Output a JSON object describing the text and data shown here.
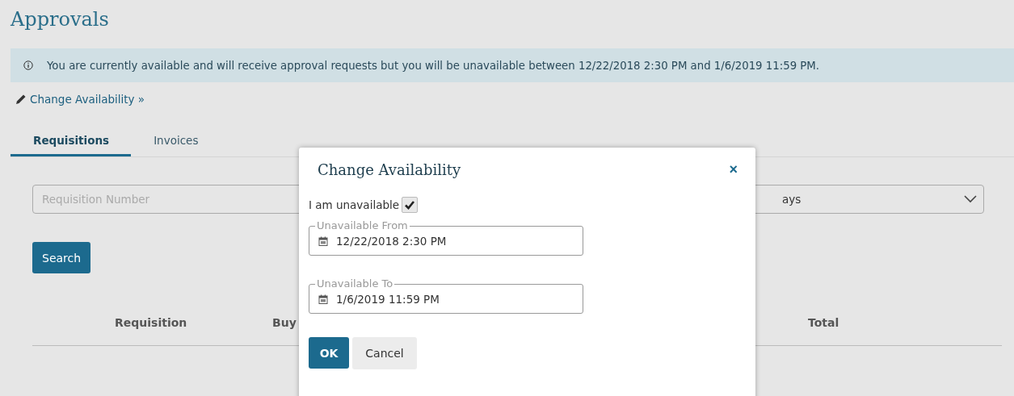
{
  "page": {
    "title": "Approvals"
  },
  "banner": {
    "text": "You are currently available and will receive approval requests but you will be unavailable between 12/22/2018 2:30 PM and 1/6/2019 11:59 PM."
  },
  "change_link": "Change Availability »",
  "tabs": [
    {
      "label": "Requisitions",
      "selected": true
    },
    {
      "label": "Invoices",
      "selected": false
    }
  ],
  "filters": {
    "search_placeholder": "Requisition Number",
    "select_value": "ays",
    "search_button": "Search"
  },
  "table": {
    "columns": [
      {
        "label": "Requisition"
      },
      {
        "label": "Buy"
      },
      {
        "label": "Total"
      }
    ]
  },
  "dialog": {
    "title": "Change Availability",
    "close": "×",
    "unavailable_label": "I am unavailable",
    "unavailable": true,
    "fields": [
      {
        "label": "Unavailable From",
        "value": "12/22/2018 2:30 PM"
      },
      {
        "label": "Unavailable To",
        "value": "1/6/2019 11:59 PM"
      }
    ],
    "buttons": [
      {
        "label": "OK",
        "kind": "primary"
      },
      {
        "label": "Cancel",
        "kind": "secondary"
      }
    ]
  }
}
